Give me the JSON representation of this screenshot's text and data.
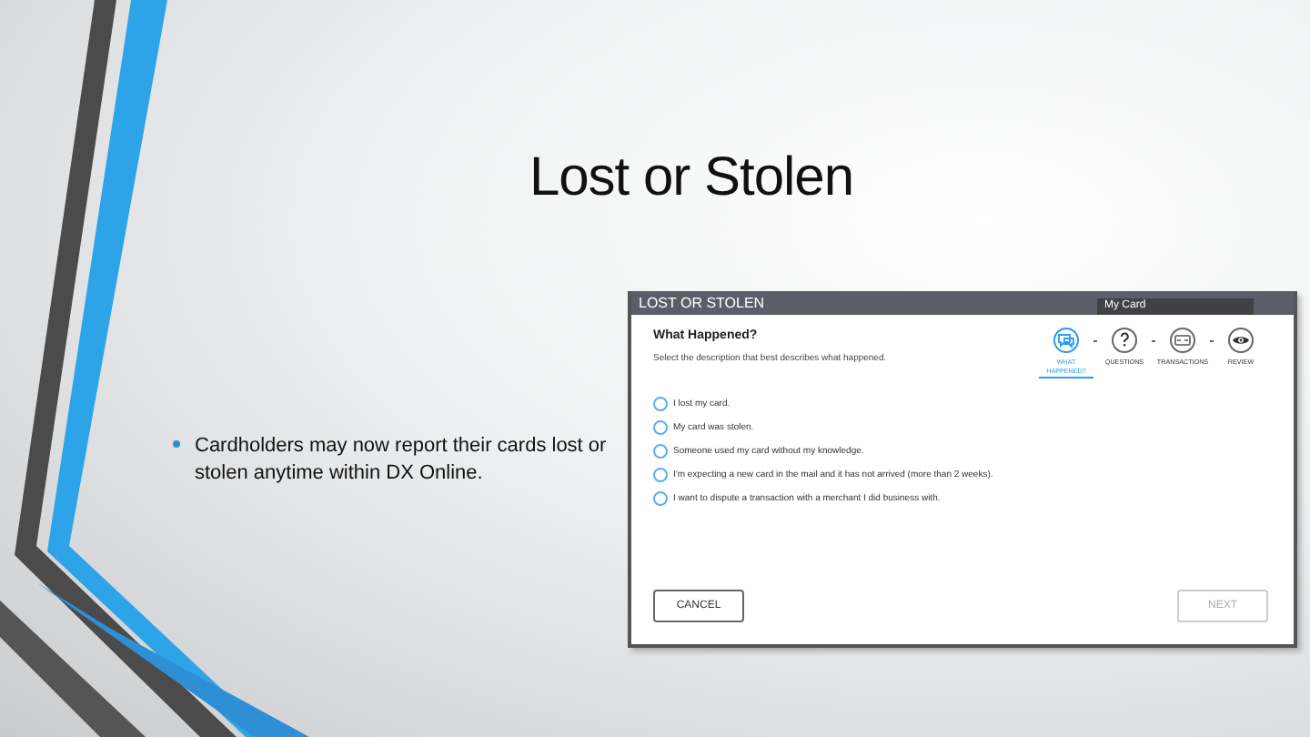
{
  "slide": {
    "title": "Lost or Stolen",
    "bullets": [
      "Cardholders may now report their cards lost or stolen anytime within DX Online."
    ]
  },
  "app": {
    "header": {
      "title": "LOST OR STOLEN",
      "card_field": "My Card"
    },
    "heading": "What Happened?",
    "instruction": "Select the description that best describes what happened.",
    "steps": [
      {
        "label": "WHAT HAPPENED?",
        "selected": true
      },
      {
        "label": "QUESTIONS",
        "selected": false
      },
      {
        "label": "TRANSACTIONS",
        "selected": false
      },
      {
        "label": "REVIEW",
        "selected": false
      }
    ],
    "options": [
      {
        "label": "I lost my card.",
        "selected": false
      },
      {
        "label": "My card was stolen.",
        "selected": false
      },
      {
        "label": "Someone used my card without my knowledge.",
        "selected": false
      },
      {
        "label": "I'm expecting a new card in the mail and it has not arrived (more than 2 weeks).",
        "selected": false
      },
      {
        "label": "I want to dispute a transaction with a merchant I did business with.",
        "selected": false
      }
    ],
    "buttons": [
      {
        "label": "CANCEL",
        "disabled": false
      },
      {
        "label": "NEXT",
        "disabled": true
      }
    ]
  }
}
